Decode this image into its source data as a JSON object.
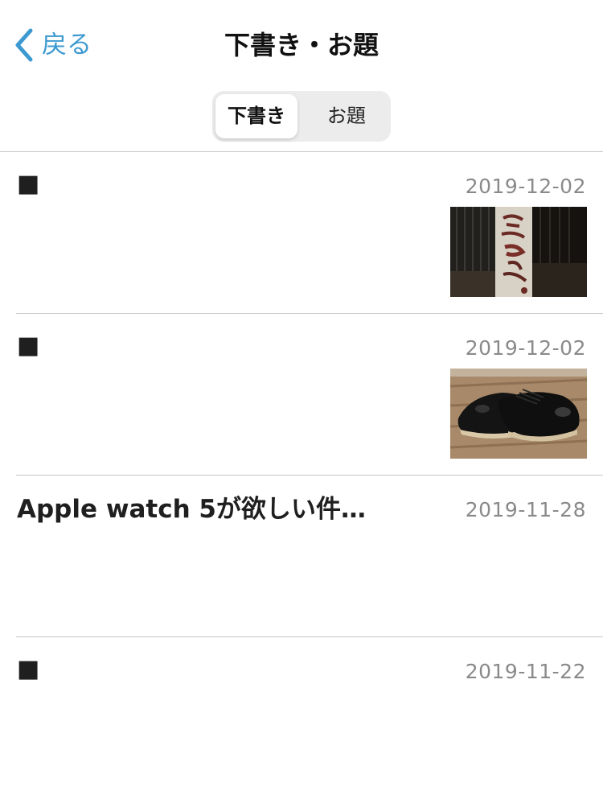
{
  "nav": {
    "back_label": "戻る",
    "title": "下書き・お題"
  },
  "segment": {
    "options": [
      {
        "label": "下書き",
        "selected": true
      },
      {
        "label": "お題",
        "selected": false
      }
    ]
  },
  "entries": [
    {
      "title": "■",
      "date": "2019-12-02",
      "thumbnail": "banner-photo-thumbnail"
    },
    {
      "title": "■",
      "date": "2019-12-02",
      "thumbnail": "shoes-photo-thumbnail"
    },
    {
      "title": "Apple watch 5が欲しい件…",
      "date": "2019-11-28",
      "thumbnail": null
    },
    {
      "title": "■",
      "date": "2019-11-22",
      "thumbnail": null
    }
  ],
  "colors": {
    "accent": "#3d9ad1",
    "date_text": "#8a8a8a",
    "segment_bg": "#ececec",
    "divider": "#c8c8c8"
  }
}
